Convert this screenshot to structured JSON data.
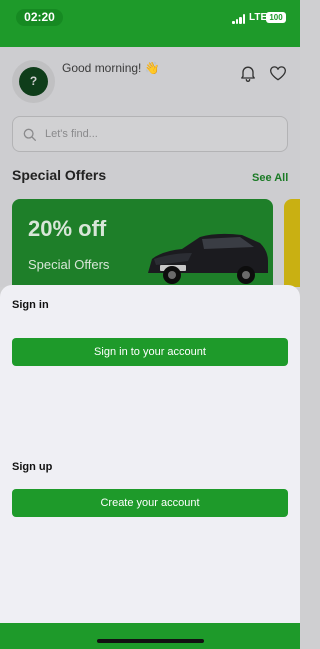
{
  "status_bar": {
    "time": "02:20",
    "network": "LTE",
    "battery": "100"
  },
  "header": {
    "avatar_glyph": "?",
    "greeting": "Good morning! 👋"
  },
  "search": {
    "placeholder": "Let's find..."
  },
  "offers": {
    "title": "Special Offers",
    "see_all": "See All",
    "card": {
      "discount": "20% off",
      "subtitle": "Special Offers"
    }
  },
  "sheet": {
    "signin_label": "Sign in",
    "signin_button": "Sign in to your account",
    "signup_label": "Sign up",
    "signup_button": "Create your account"
  },
  "colors": {
    "brand_green": "#1e9a2a",
    "offer_card": "#1e7f29",
    "second_card": "#c9b012"
  }
}
